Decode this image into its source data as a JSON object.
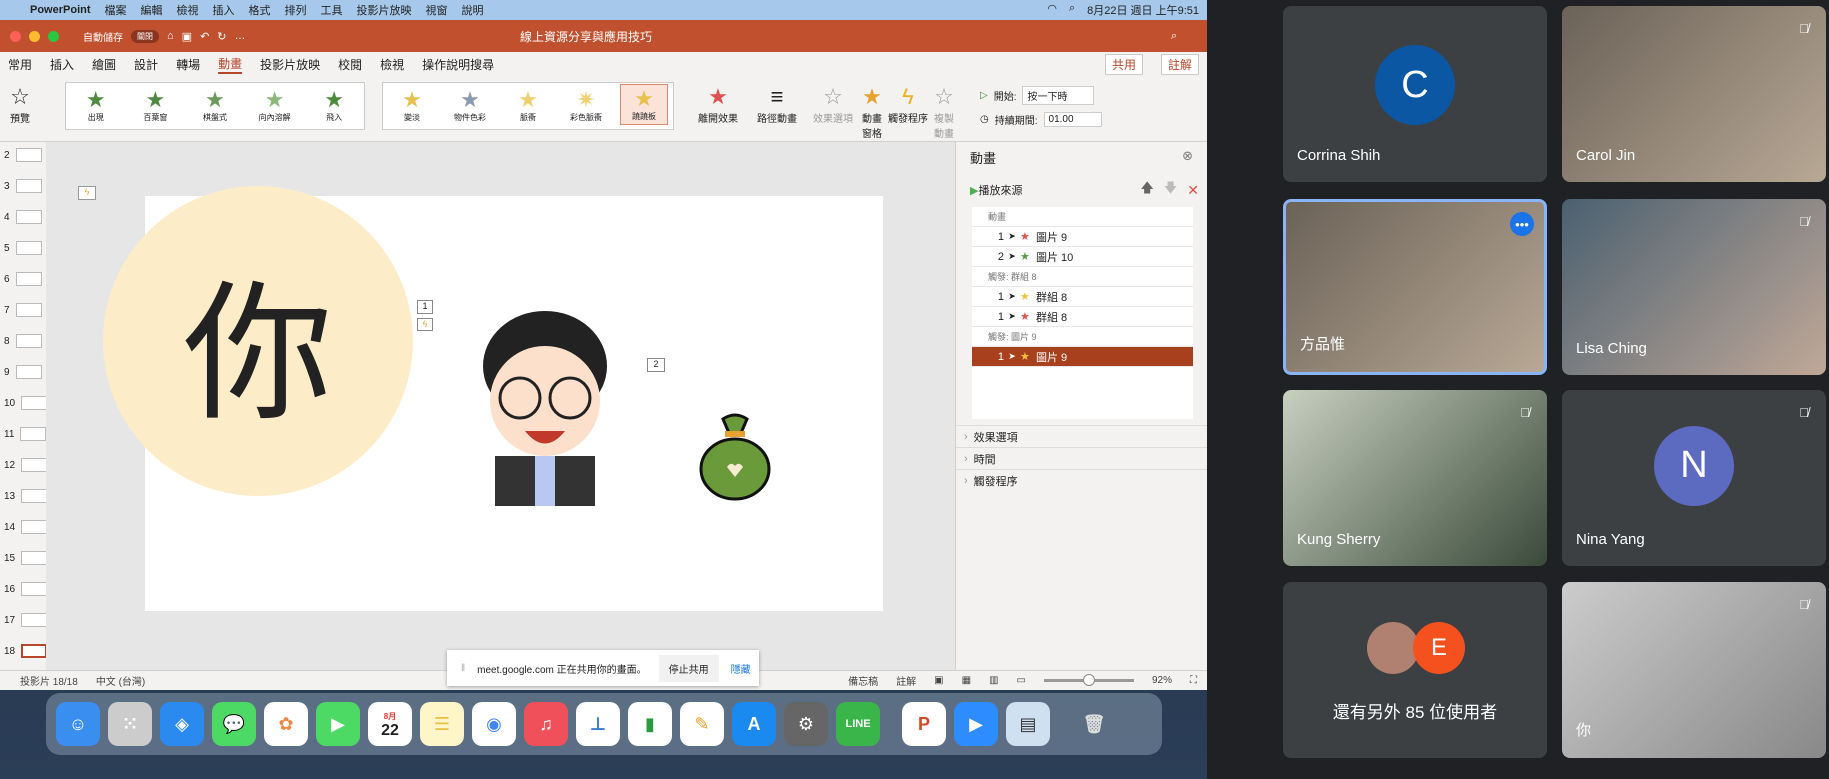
{
  "menubar": {
    "app": "PowerPoint",
    "items": [
      "檔案",
      "編輯",
      "檢視",
      "插入",
      "格式",
      "排列",
      "工具",
      "投影片放映",
      "視窗",
      "說明"
    ],
    "clock": "8月22日 週日 上午9:51"
  },
  "titlebar": {
    "autosave": "自動儲存",
    "autosave_state": "關閉",
    "doc_title": "線上資源分享與應用技巧"
  },
  "tabs": [
    "常用",
    "插入",
    "繪圖",
    "設計",
    "轉場",
    "動畫",
    "投影片放映",
    "校閱",
    "檢視"
  ],
  "tell_me": "操作說明搜尋",
  "share": "共用",
  "comments": "註解",
  "ribbon": {
    "preview": "預覽",
    "entrance": [
      "出現",
      "百葉窗",
      "棋盤式",
      "向內溶解",
      "飛入"
    ],
    "emphasis": [
      "變淡",
      "物件色彩",
      "脈衝",
      "彩色脈衝",
      "蹺蹺板"
    ],
    "exit": "離開效果",
    "path": "路徑動畫",
    "effect_options": "效果選項",
    "anim_pane": "動畫窗格",
    "trigger": "觸發程序",
    "copy_anim": "複製動畫",
    "start_label": "開始:",
    "start_value": "按一下時",
    "duration_label": "持續期間:",
    "duration_value": "01.00"
  },
  "thumbs": [
    "2",
    "3",
    "4",
    "5",
    "6",
    "7",
    "8",
    "9",
    "10",
    "11",
    "12",
    "13",
    "14",
    "15",
    "16",
    "17",
    "18"
  ],
  "slide": {
    "character": "你",
    "tag1": "1",
    "tag2": "2"
  },
  "pane": {
    "title": "動畫",
    "play": "播放來源",
    "groups": [
      {
        "header": "動畫",
        "rows": [
          {
            "n": "1",
            "name": "圖片 9",
            "color": "#d9534f"
          },
          {
            "n": "2",
            "name": "圖片 10",
            "color": "#5a9a4a"
          }
        ]
      },
      {
        "header": "觸發: 群組 8",
        "rows": [
          {
            "n": "1",
            "name": "群組 8",
            "color": "#f0c040"
          },
          {
            "n": "1",
            "name": "群組 8",
            "color": "#d9534f"
          }
        ]
      },
      {
        "header": "觸發: 圖片 9",
        "rows": [
          {
            "n": "1",
            "name": "圖片 9",
            "color": "#f0c040",
            "selected": true
          }
        ]
      }
    ],
    "sections": [
      "效果選項",
      "時間",
      "觸發程序"
    ]
  },
  "status": {
    "slide": "投影片 18/18",
    "lang": "中文 (台灣)",
    "notes": "備忘稿",
    "comments": "註解",
    "zoom": "92%",
    "zoom_fraction": 0.5
  },
  "share_bar": {
    "text": "meet.google.com 正在共用你的畫面。",
    "stop": "停止共用",
    "hide": "隱藏"
  },
  "dock": {
    "calendar_month": "8月",
    "calendar_day": "22"
  },
  "meet": {
    "tiles": [
      {
        "name": "Corrina Shih",
        "initial": "C",
        "color": "#0b57a4"
      },
      {
        "name": "Carol Jin"
      },
      {
        "name": "方品惟"
      },
      {
        "name": "Lisa Ching"
      },
      {
        "name": "Kung Sherry"
      },
      {
        "name": "Nina Yang",
        "initial": "N",
        "color": "#5c6bc0"
      },
      {
        "others": "還有另外 85 位使用者",
        "initial": "E"
      },
      {
        "name": "你"
      }
    ]
  }
}
